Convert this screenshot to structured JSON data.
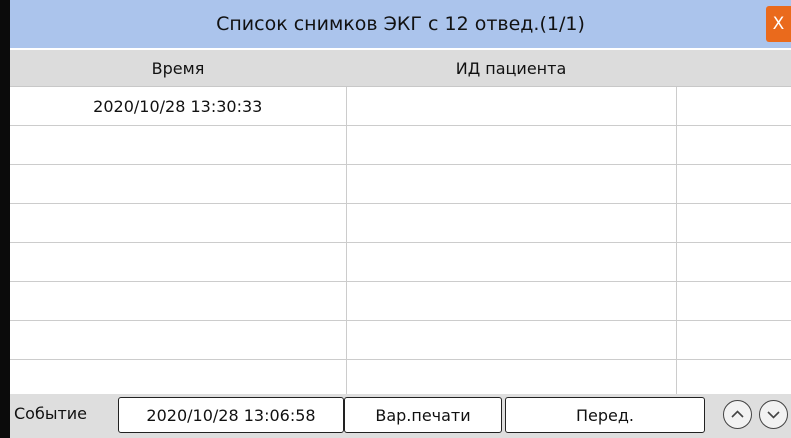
{
  "dialog": {
    "title": "Список снимков ЭКГ с 12 отвед.(1/1)",
    "close_label": "X"
  },
  "table": {
    "headers": [
      "Время",
      "ИД пациента",
      ""
    ],
    "rows": [
      [
        "2020/10/28 13:30:33",
        "",
        ""
      ],
      [
        "",
        "",
        ""
      ],
      [
        "",
        "",
        ""
      ],
      [
        "",
        "",
        ""
      ],
      [
        "",
        "",
        ""
      ],
      [
        "",
        "",
        ""
      ],
      [
        "",
        "",
        ""
      ],
      [
        "",
        "",
        ""
      ]
    ]
  },
  "footer": {
    "event_label": "Событие",
    "event_time": "2020/10/28 13:06:58",
    "print_options_label": "Вар.печати",
    "transfer_label": "Перед.",
    "up_icon": "chevron-up-circle-icon",
    "down_icon": "chevron-down-circle-icon"
  },
  "colors": {
    "title_bar": "#abc4ec",
    "close_button": "#ea6a1c",
    "header_row": "#dcdcdc",
    "footer": "#dedede"
  }
}
